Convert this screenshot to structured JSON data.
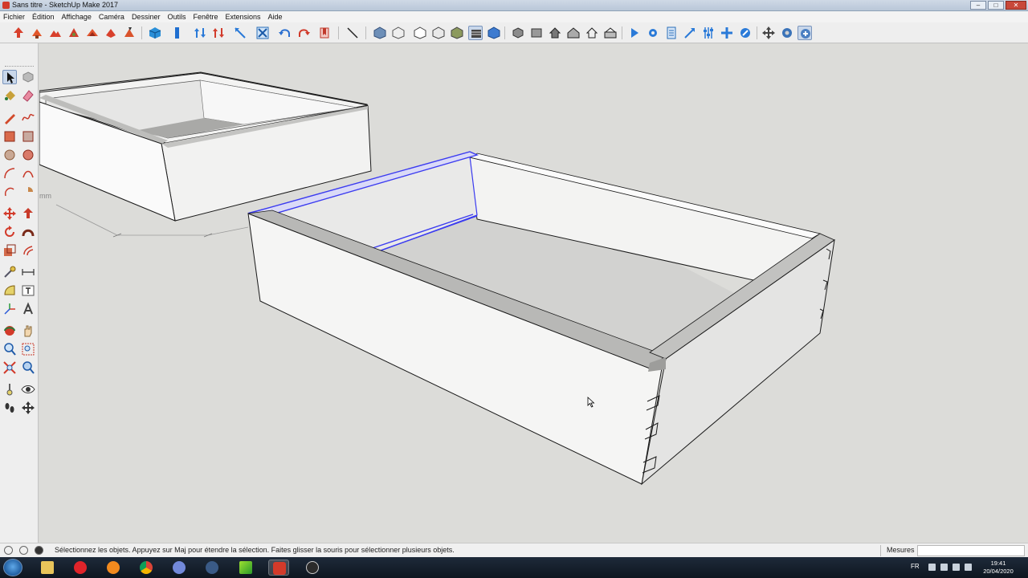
{
  "window": {
    "title": "Sans titre - SketchUp Make 2017",
    "controls": [
      "–",
      "□",
      "✕"
    ]
  },
  "menu": [
    "Fichier",
    "Édition",
    "Affichage",
    "Caméra",
    "Dessiner",
    "Outils",
    "Fenêtre",
    "Extensions",
    "Aide"
  ],
  "viewport": {
    "dimension_unit_fragment": "mm"
  },
  "status": {
    "hint": "Sélectionnez les objets. Appuyez sur Maj pour étendre la sélection. Faites glisser la souris pour sélectionner plusieurs objets.",
    "measure_label": "Mesures",
    "measure_value": ""
  },
  "taskbar": {
    "language": "FR",
    "time": "19:41",
    "date": "20/04/2020"
  },
  "colors": {
    "selection": "#3b3bf0",
    "viewport_bg": "#dcdcd9",
    "toolbar_bg": "#eeeeee",
    "taskbar_bg": "#0e1620"
  }
}
